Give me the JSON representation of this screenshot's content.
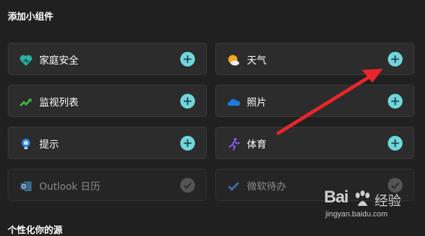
{
  "section_title": "添加小组件",
  "widgets": [
    {
      "label": "家庭安全",
      "icon": "family-safety-icon",
      "action": "add"
    },
    {
      "label": "天气",
      "icon": "weather-icon",
      "action": "add"
    },
    {
      "label": "监视列表",
      "icon": "watchlist-icon",
      "action": "add"
    },
    {
      "label": "照片",
      "icon": "onedrive-photos-icon",
      "action": "add"
    },
    {
      "label": "提示",
      "icon": "tips-lightbulb-icon",
      "action": "add"
    },
    {
      "label": "体育",
      "icon": "sports-runner-icon",
      "action": "add"
    },
    {
      "label": "Outlook 日历",
      "icon": "outlook-calendar-icon",
      "action": "added"
    },
    {
      "label": "微软待办",
      "icon": "microsoft-todo-icon",
      "action": "added"
    }
  ],
  "footer_title": "个性化你的源",
  "watermark": {
    "brand": "Bai",
    "brand_suffix": "经验",
    "url": "jingyan.baidu.com"
  },
  "colors": {
    "background": "#202020",
    "card": "#2c2c2c",
    "add_button": "#6fd7dc",
    "arrow": "#e8262a"
  }
}
